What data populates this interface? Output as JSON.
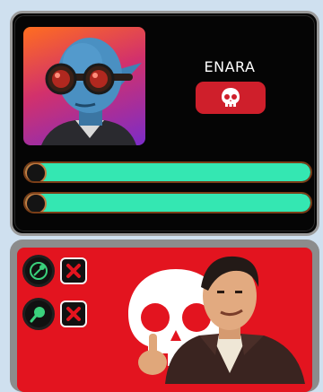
{
  "enemy": {
    "name": "ENARA",
    "portrait": "blue-alien-with-goggles",
    "status_icon": "skull-icon",
    "bars": [
      {
        "level": 1.0,
        "color": "#34e7b2"
      },
      {
        "level": 1.0,
        "color": "#34e7b2"
      }
    ]
  },
  "panel": {
    "background_color": "#e3141f",
    "abilities": [
      {
        "icon": "link-icon",
        "status": "disabled"
      },
      {
        "icon": "magnifier-icon",
        "status": "disabled"
      }
    ],
    "big_icon": "skull-icon",
    "character": "smirking-man-thumbs-up"
  }
}
